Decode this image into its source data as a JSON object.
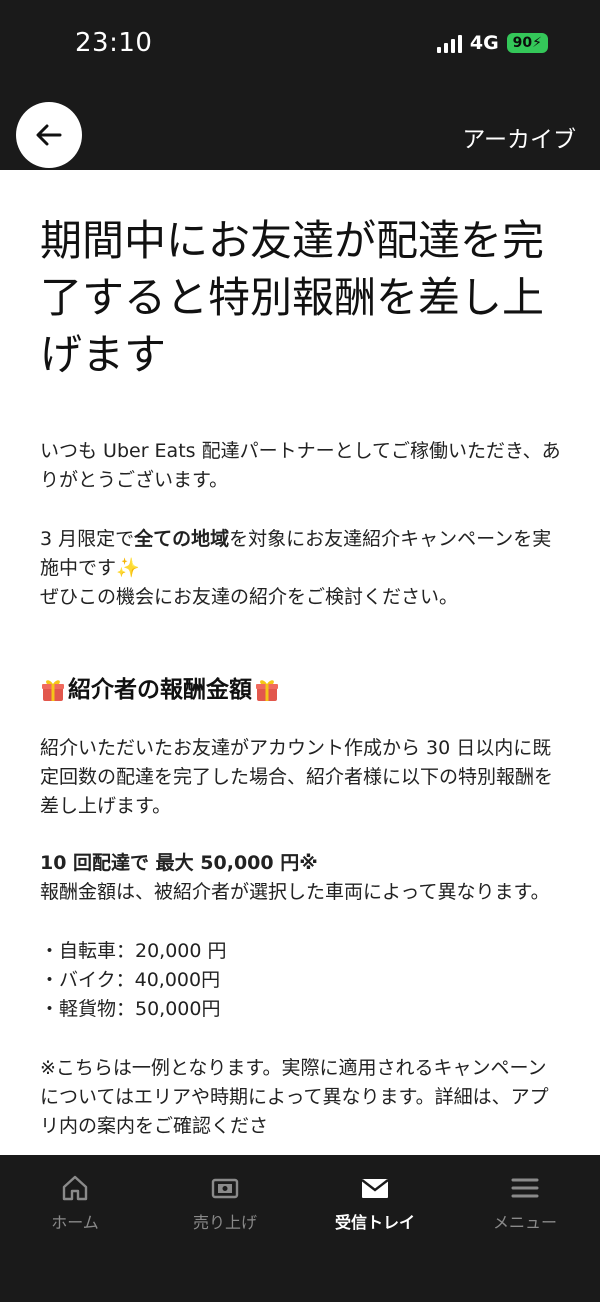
{
  "status": {
    "time": "23:10",
    "network": "4G",
    "battery": "90"
  },
  "nav": {
    "archive_label": "アーカイブ"
  },
  "article": {
    "title": "期間中にお友達が配達を完了すると特別報酬を差し上げます",
    "intro": "いつも Uber Eats 配達パートナーとしてご稼働いただき、ありがとうございます。",
    "campaign_pre": "3 月限定で",
    "campaign_bold": "全ての地域",
    "campaign_post": "を対象にお友達紹介キャンペーンを実施中です",
    "campaign_line2": "ぜひこの機会にお友達の紹介をご検討ください。",
    "section_heading": "紹介者の報酬金額",
    "reward_desc": "紹介いただいたお友達がアカウント作成から 30 日以内に既定回数の配達を完了した場合、紹介者様に以下の特別報酬を差し上げます。",
    "max_reward": "10 回配達で 最大 50,000 円※",
    "vehicle_note": "報酬金額は、被紹介者が選択した車両によって異なります。",
    "rewards": [
      "・自転車：20,000 円",
      "・バイク：40,000円",
      "・軽貨物：50,000円"
    ],
    "disclaimer": "※こちらは一例となります。実際に適用されるキャンペーンについてはエリアや時期によって異なります。詳細は、アプリ内の案内をご確認くださ"
  },
  "tabs": [
    {
      "label": "ホーム",
      "icon": "home-icon"
    },
    {
      "label": "売り上げ",
      "icon": "earnings-icon"
    },
    {
      "label": "受信トレイ",
      "icon": "mail-icon"
    },
    {
      "label": "メニュー",
      "icon": "menu-icon"
    }
  ],
  "colors": {
    "bar_bg": "#1a1a1a",
    "battery_green": "#34c759",
    "tab_inactive": "#8a8a8a",
    "tab_active": "#ffffff"
  }
}
